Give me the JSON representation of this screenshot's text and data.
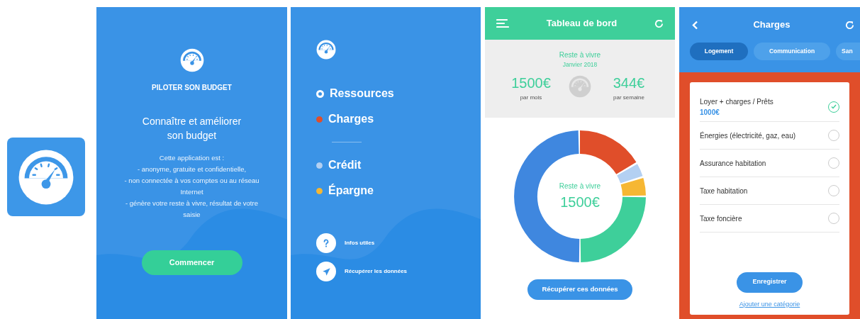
{
  "welcome": {
    "title": "PILOTER SON BUDGET",
    "headline": "Connaître et améliorer son budget",
    "description": [
      "Cette application est :",
      "- anonyme, gratuite et confidentielle,",
      "- non connectée à vos comptes ou au réseau Internet",
      "- génère votre reste à vivre, résultat de votre saisie"
    ],
    "button": "Commencer"
  },
  "menu": {
    "items": [
      {
        "label": "Ressources",
        "kind": "ring",
        "color": "#ffffff"
      },
      {
        "label": "Charges",
        "kind": "dot",
        "color": "#e04e2a"
      },
      {
        "label": "Crédit",
        "kind": "dot",
        "color": "#b3d0f2"
      },
      {
        "label": "Épargne",
        "kind": "dot",
        "color": "#f6b733"
      }
    ],
    "links": [
      {
        "label": "Infos utiles",
        "kind": "help"
      },
      {
        "label": "Récupérer les données",
        "kind": "send"
      }
    ]
  },
  "dashboard": {
    "title": "Tableau de bord",
    "subtitle": "Reste à vivre",
    "period": "Janvier 2018",
    "monthly": {
      "value": "1500€",
      "label": "par mois"
    },
    "weekly": {
      "value": "344€",
      "label": "par semaine"
    },
    "center_label": "Reste à vivre",
    "center_value": "1500€",
    "button": "Récupérer ces données"
  },
  "charges": {
    "title": "Charges",
    "tabs": [
      {
        "label": "Logement",
        "selected": true
      },
      {
        "label": "Communication",
        "selected": false
      },
      {
        "label": "San",
        "selected": false
      }
    ],
    "items": [
      {
        "label": "Loyer + charges / Prêts",
        "amount": "1000€",
        "checked": true
      },
      {
        "label": "Énergies (électricité, gaz, eau)",
        "checked": false
      },
      {
        "label": "Assurance habitation",
        "checked": false
      },
      {
        "label": "Taxe habitation",
        "checked": false
      },
      {
        "label": "Taxe foncière",
        "checked": false
      }
    ],
    "button": "Enregistrer",
    "link": "Ajouter une catégorie"
  }
}
